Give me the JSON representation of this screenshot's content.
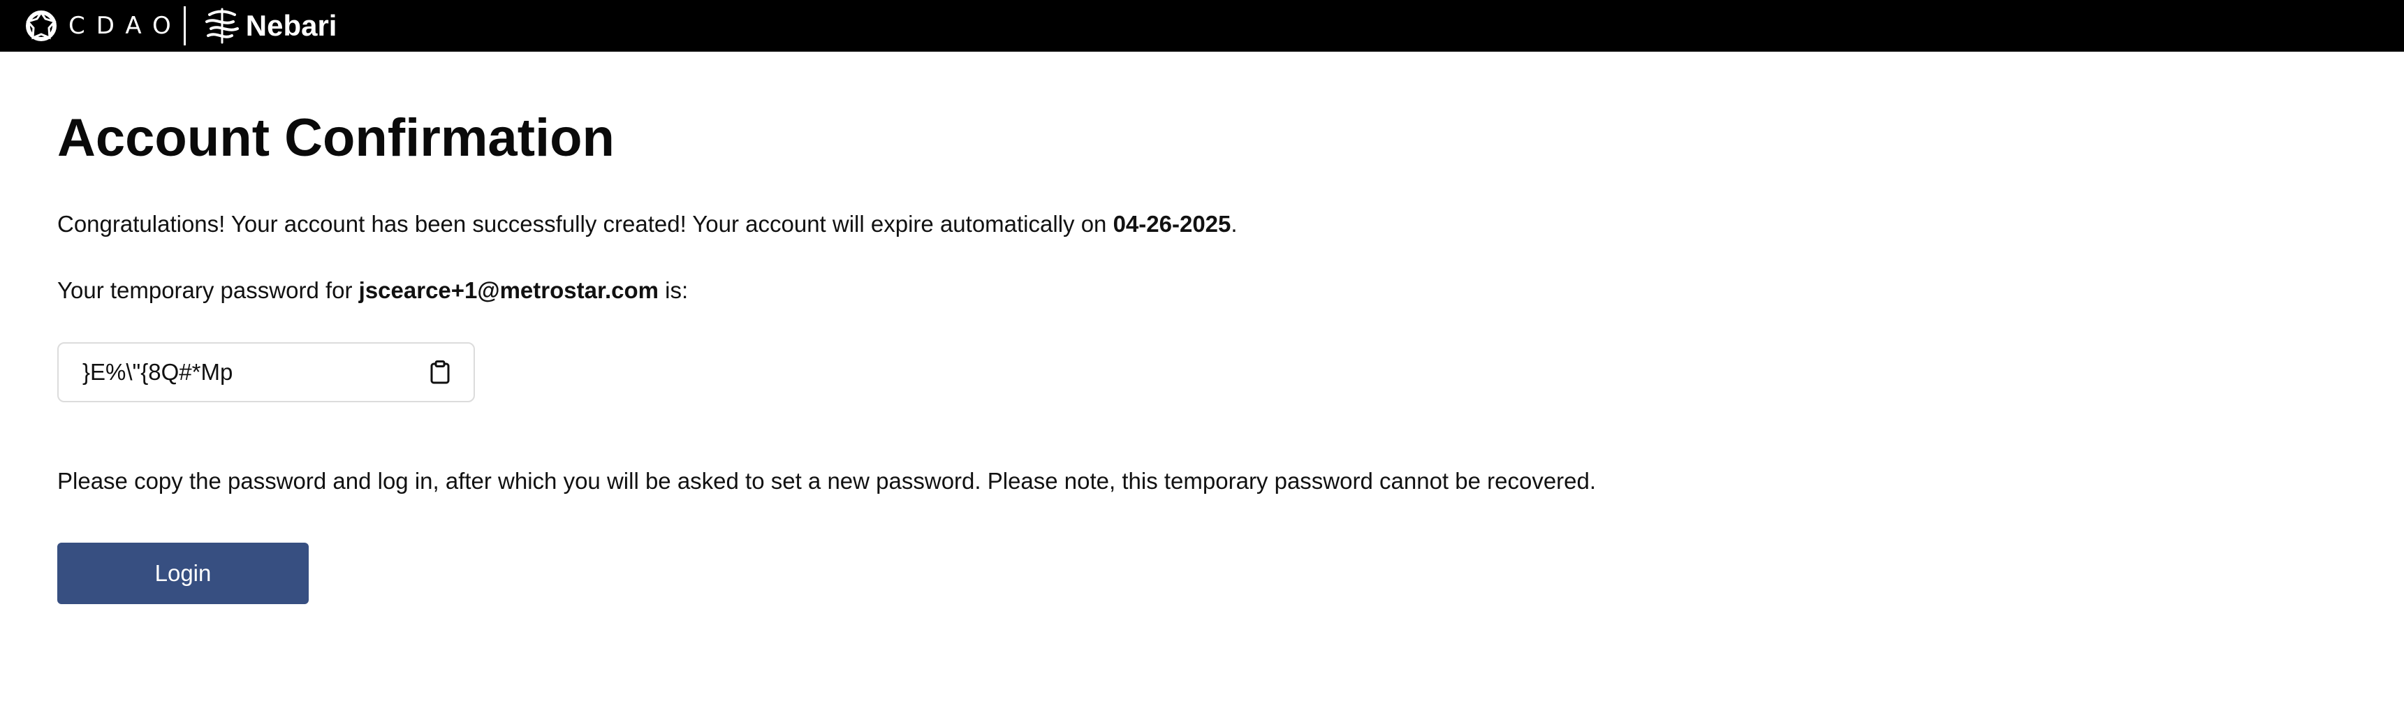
{
  "header": {
    "cdao_logo_text": "CDAO",
    "nebari_logo_text": "Nebari"
  },
  "main": {
    "title": "Account Confirmation",
    "congrats_text": "Congratulations! Your account has been successfully created! Your account will expire automatically on ",
    "expiry_date": "04-26-2025",
    "congrats_suffix": ".",
    "temp_prefix": "Your temporary password for ",
    "email": "jscearce+1@metrostar.com",
    "temp_suffix": " is:",
    "password": "}E%\\\"{8Q#*Mp",
    "note_text": "Please copy the password and log in, after which you will be asked to set a new password. Please note, this temporary password cannot be recovered.",
    "login_label": "Login"
  },
  "colors": {
    "topbar": "#000000",
    "login_button": "#374f81",
    "box_border": "#dcdcdc"
  },
  "icons": {
    "cdao": "cdao-logo-icon",
    "nebari": "nebari-logo-icon",
    "copy": "clipboard-icon"
  }
}
